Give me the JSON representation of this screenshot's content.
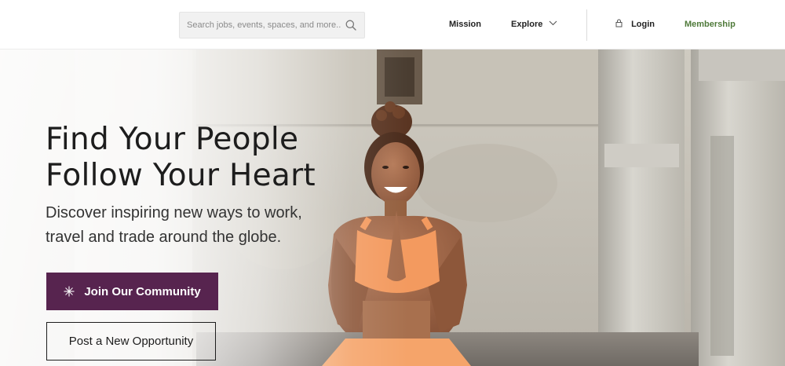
{
  "header": {
    "search": {
      "placeholder": "Search jobs, events, spaces, and more...",
      "value": ""
    },
    "nav": {
      "mission": "Mission",
      "explore": "Explore",
      "login": "Login",
      "membership": "Membership"
    },
    "icons": {
      "search": "search-icon",
      "explore_dropdown": "chevron-down-icon",
      "login": "lock-icon"
    }
  },
  "hero": {
    "title_line1": "Find Your People",
    "title_line2": "Follow Your Heart",
    "subtitle_line1": "Discover inspiring new ways to work,",
    "subtitle_line2": "travel and trade around the globe.",
    "primary_cta": "Join Our Community",
    "secondary_cta": "Post a New Opportunity",
    "icons": {
      "primary_cta": "sparkle-icon"
    }
  },
  "colors": {
    "primary_button": "#57244f",
    "membership_link": "#4f7a3a",
    "text_dark": "#1d1d1d"
  }
}
